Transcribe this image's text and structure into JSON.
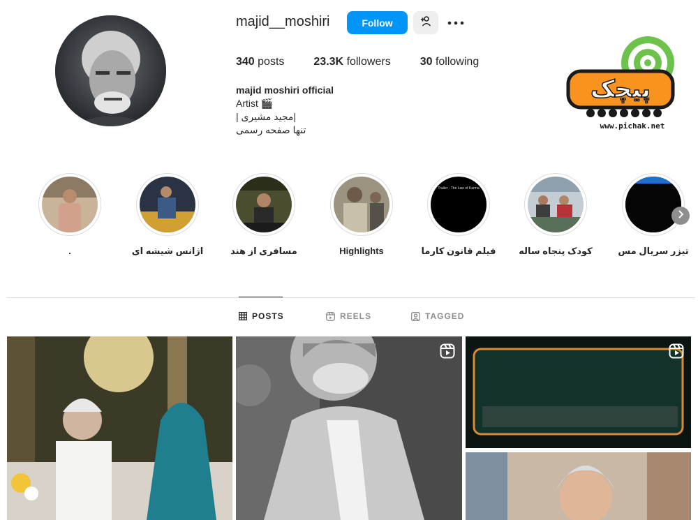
{
  "profile": {
    "username": "majid__moshiri",
    "follow_label": "Follow",
    "stats": {
      "posts_count": "340",
      "posts_label": "posts",
      "followers_count": "23.3K",
      "followers_label": "followers",
      "following_count": "30",
      "following_label": "following"
    },
    "bio": {
      "full_name": "majid moshiri official",
      "category": "Artist 🎬",
      "line1": "|مجید مشیری |",
      "line2": "تنها صفحه رسمی"
    }
  },
  "watermark": {
    "url": "www.pichak.net",
    "logo_text": "پیچک"
  },
  "highlights": [
    {
      "label": "."
    },
    {
      "label": "اژانس شیشه ای"
    },
    {
      "label": "مسافری از هند"
    },
    {
      "label": "Highlights"
    },
    {
      "label": "فیلم قانون کارما",
      "thumb_text": "Trailer - The Law of Karma"
    },
    {
      "label": "کودک پنجاه ساله"
    },
    {
      "label": "تیزر سریال مس"
    }
  ],
  "tabs": [
    {
      "label": "POSTS",
      "icon": "grid-icon",
      "active": true
    },
    {
      "label": "REELS",
      "icon": "reels-icon",
      "active": false
    },
    {
      "label": "TAGGED",
      "icon": "tagged-icon",
      "active": false
    }
  ],
  "colors": {
    "accent": "#0095f6",
    "text": "#262626",
    "muted": "#8e8e8e",
    "border": "#dbdbdb"
  }
}
